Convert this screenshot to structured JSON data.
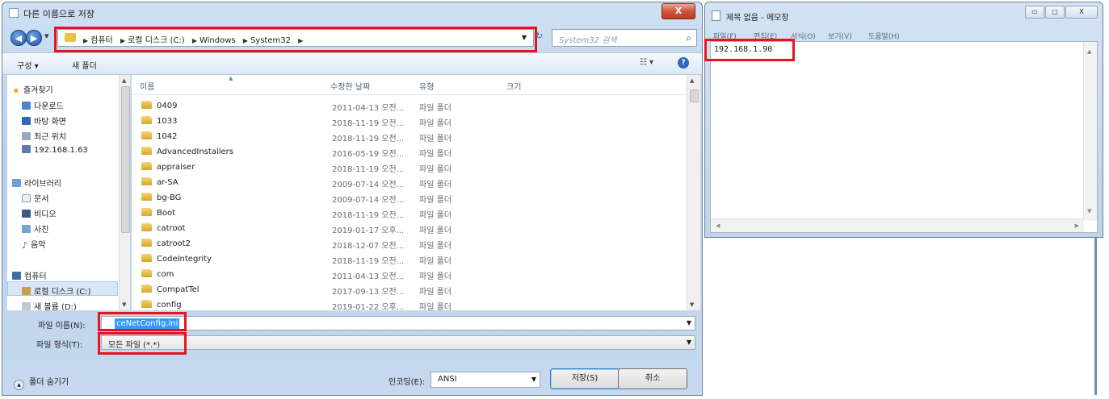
{
  "dialog": {
    "title": "다른 이름으로 저장",
    "close": "X",
    "address_crumbs": [
      "컴퓨터",
      "로컬 디스크 (C:)",
      "Windows",
      "System32"
    ],
    "search_placeholder": "System32 검색",
    "toolbar": {
      "organize": "구성 ▾",
      "new_folder": "새 폴더",
      "view": "☷ ▾",
      "help": "?"
    },
    "nav": {
      "favorites": "즐겨찾기",
      "downloads": "다운로드",
      "desktop": "바탕 화면",
      "recent": "최근 위치",
      "network_ip": "192.168.1.63",
      "libraries": "라이브러리",
      "documents": "문서",
      "videos": "비디오",
      "pictures": "사진",
      "music": "음악",
      "computer": "컴퓨터",
      "local_disk": "로컬 디스크 (C:)",
      "new_volume": "새 볼륨 (D:)"
    },
    "columns": {
      "name": "이름",
      "date": "수정한 날짜",
      "type": "유형",
      "size": "크기"
    },
    "files": [
      {
        "name": "0409",
        "date": "2011-04-13 오전...",
        "type": "파일 폴더"
      },
      {
        "name": "1033",
        "date": "2018-11-19 오전...",
        "type": "파일 폴더"
      },
      {
        "name": "1042",
        "date": "2018-11-19 오전...",
        "type": "파일 폴더"
      },
      {
        "name": "AdvancedInstallers",
        "date": "2016-05-19 오전...",
        "type": "파일 폴더"
      },
      {
        "name": "appraiser",
        "date": "2018-11-19 오전...",
        "type": "파일 폴더"
      },
      {
        "name": "ar-SA",
        "date": "2009-07-14 오전...",
        "type": "파일 폴더"
      },
      {
        "name": "bg-BG",
        "date": "2009-07-14 오전...",
        "type": "파일 폴더"
      },
      {
        "name": "Boot",
        "date": "2018-11-19 오전...",
        "type": "파일 폴더"
      },
      {
        "name": "catroot",
        "date": "2019-01-17 오후...",
        "type": "파일 폴더"
      },
      {
        "name": "catroot2",
        "date": "2018-12-07 오전...",
        "type": "파일 폴더"
      },
      {
        "name": "CodeIntegrity",
        "date": "2018-11-19 오전...",
        "type": "파일 폴더"
      },
      {
        "name": "com",
        "date": "2011-04-13 오전...",
        "type": "파일 폴더"
      },
      {
        "name": "CompatTel",
        "date": "2017-09-13 오전...",
        "type": "파일 폴더"
      },
      {
        "name": "config",
        "date": "2019-01-22 오후...",
        "type": "파일 폴더"
      }
    ],
    "filename_label": "파일 이름(N):",
    "filename_value": "ceNetConfig.ini",
    "filetype_label": "파일 형식(T):",
    "filetype_value": "모든 파일 (*.*)",
    "hide_folders": "폴더 숨기기",
    "encoding_label": "인코딩(E):",
    "encoding_value": "ANSI",
    "save_button": "저장(S)",
    "cancel_button": "취소"
  },
  "notepad": {
    "title": "제목 없음 - 메모장",
    "menus": [
      "파일(F)",
      "편집(E)",
      "서식(O)",
      "보기(V)",
      "도움말(H)"
    ],
    "content": "192.168.1.90",
    "controls": {
      "minimize": "▭",
      "maximize": "▢",
      "close": "X"
    }
  },
  "colors": {
    "highlight": "#e8141c",
    "selection": "#3399ff"
  }
}
